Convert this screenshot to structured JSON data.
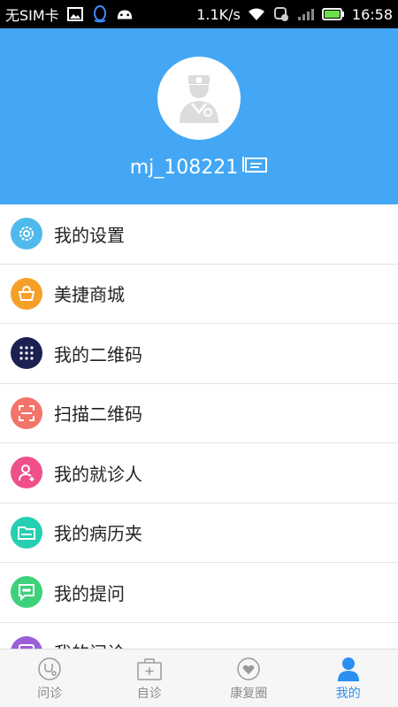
{
  "status_bar": {
    "carrier": "无SIM卡",
    "speed": "1.1K/s",
    "time": "16:58",
    "icons": [
      "image-icon",
      "qq-icon",
      "android-icon",
      "wifi-icon",
      "nfc-icon",
      "signal-icon",
      "battery-icon"
    ]
  },
  "profile": {
    "username": "mj_108221",
    "avatar_icon": "doctor-avatar-icon",
    "badge_icon": "id-card-icon"
  },
  "colors": {
    "header_bg": "#43a7f5",
    "tab_active": "#2a8ff0",
    "tab_inactive": "#8a8a8a"
  },
  "menu": {
    "items": [
      {
        "label": "我的设置",
        "icon": "gear-icon",
        "color": "#4fb9ec"
      },
      {
        "label": "美捷商城",
        "icon": "shopping-basket-icon",
        "color": "#f6a02a"
      },
      {
        "label": "我的二维码",
        "icon": "qr-grid-icon",
        "color": "#1b2150"
      },
      {
        "label": "扫描二维码",
        "icon": "scan-icon",
        "color": "#f2746b"
      },
      {
        "label": "我的就诊人",
        "icon": "person-add-icon",
        "color": "#f0508a"
      },
      {
        "label": "我的病历夹",
        "icon": "folder-icon",
        "color": "#26cfb1"
      },
      {
        "label": "我的提问",
        "icon": "chat-icon",
        "color": "#3cd17a"
      },
      {
        "label": "我的问诊",
        "icon": "consult-icon",
        "color": "#9b5fd8"
      }
    ]
  },
  "tabbar": {
    "tabs": [
      {
        "label": "问诊",
        "icon": "stethoscope-icon",
        "active": false
      },
      {
        "label": "自诊",
        "icon": "medical-kit-icon",
        "active": false
      },
      {
        "label": "康复圈",
        "icon": "heart-circle-icon",
        "active": false
      },
      {
        "label": "我的",
        "icon": "user-icon",
        "active": true
      }
    ]
  }
}
